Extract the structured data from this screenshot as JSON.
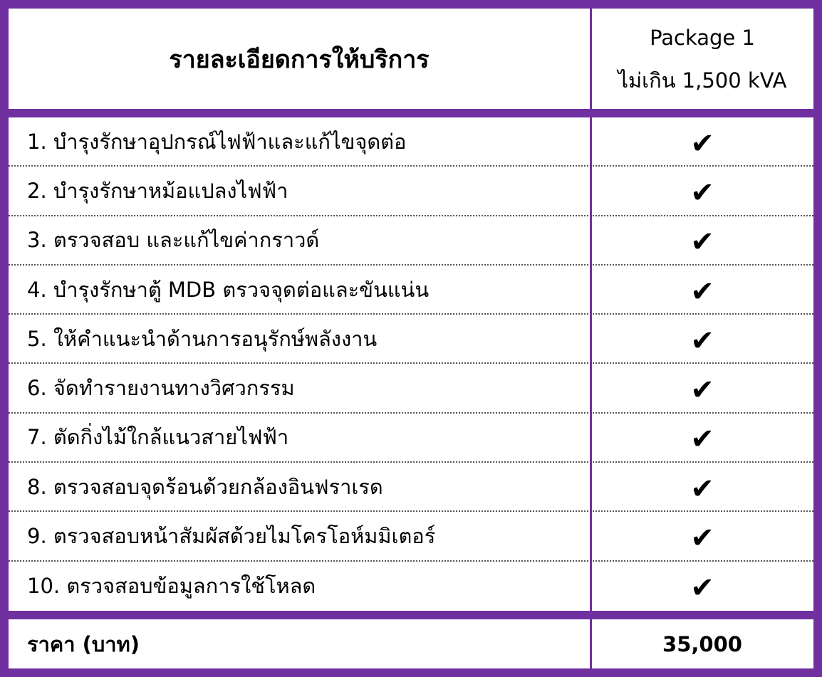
{
  "header": {
    "title": "รายละเอียดการให้บริการ",
    "package_name": "Package 1",
    "package_capacity": "ไม่เกิน 1,500 kVA"
  },
  "check_symbol": "✔",
  "services": [
    "1. บำรุงรักษาอุปกรณ์ไฟฟ้าและแก้ไขจุดต่อ",
    "2. บำรุงรักษาหม้อแปลงไฟฟ้า",
    "3. ตรวจสอบ และแก้ไขค่ากราวด์",
    "4. บำรุงรักษาตู้ MDB ตรวจจุดต่อและขันแน่น",
    "5. ให้คำแนะนำด้านการอนุรักษ์พลังงาน",
    "6. จัดทำรายงานทางวิศวกรรม",
    "7. ตัดกิ่งไม้ใกล้แนวสายไฟฟ้า",
    "8. ตรวจสอบจุดร้อนด้วยกล้องอินฟราเรด",
    "9. ตรวจสอบหน้าสัมผัสด้วยไมโครโอห์มมิเตอร์",
    "10. ตรวจสอบข้อมูลการใช้โหลด"
  ],
  "price": {
    "label": "ราคา (บาท)",
    "value": "35,000"
  },
  "colors": {
    "border": "#7030a0"
  }
}
